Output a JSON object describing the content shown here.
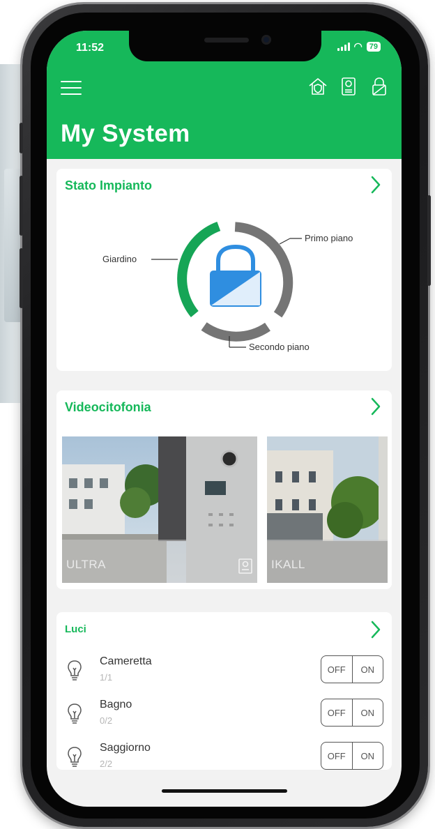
{
  "status_bar": {
    "time": "11:52",
    "battery": "79"
  },
  "header": {
    "title": "My System",
    "icons": [
      "menu-icon",
      "house-shield-icon",
      "intercom-icon",
      "lock-icon"
    ]
  },
  "stato": {
    "title": "Stato Impianto",
    "zones": [
      "Giardino",
      "Primo piano",
      "Secondo piano"
    ],
    "colors": {
      "active": "#16a556",
      "inactive": "#757575",
      "lock": "#2f8ee0"
    }
  },
  "video": {
    "title": "Videocitofonia",
    "cameras": [
      {
        "label": "ULTRA"
      },
      {
        "label": "IKALL"
      }
    ]
  },
  "luci": {
    "title": "Luci",
    "off_label": "OFF",
    "on_label": "ON",
    "rooms": [
      {
        "name": "Cameretta",
        "count": "1/1"
      },
      {
        "name": "Bagno",
        "count": "0/2"
      },
      {
        "name": "Saggiorno",
        "count": "2/2"
      }
    ]
  },
  "colors": {
    "brand": "#16b85a"
  }
}
